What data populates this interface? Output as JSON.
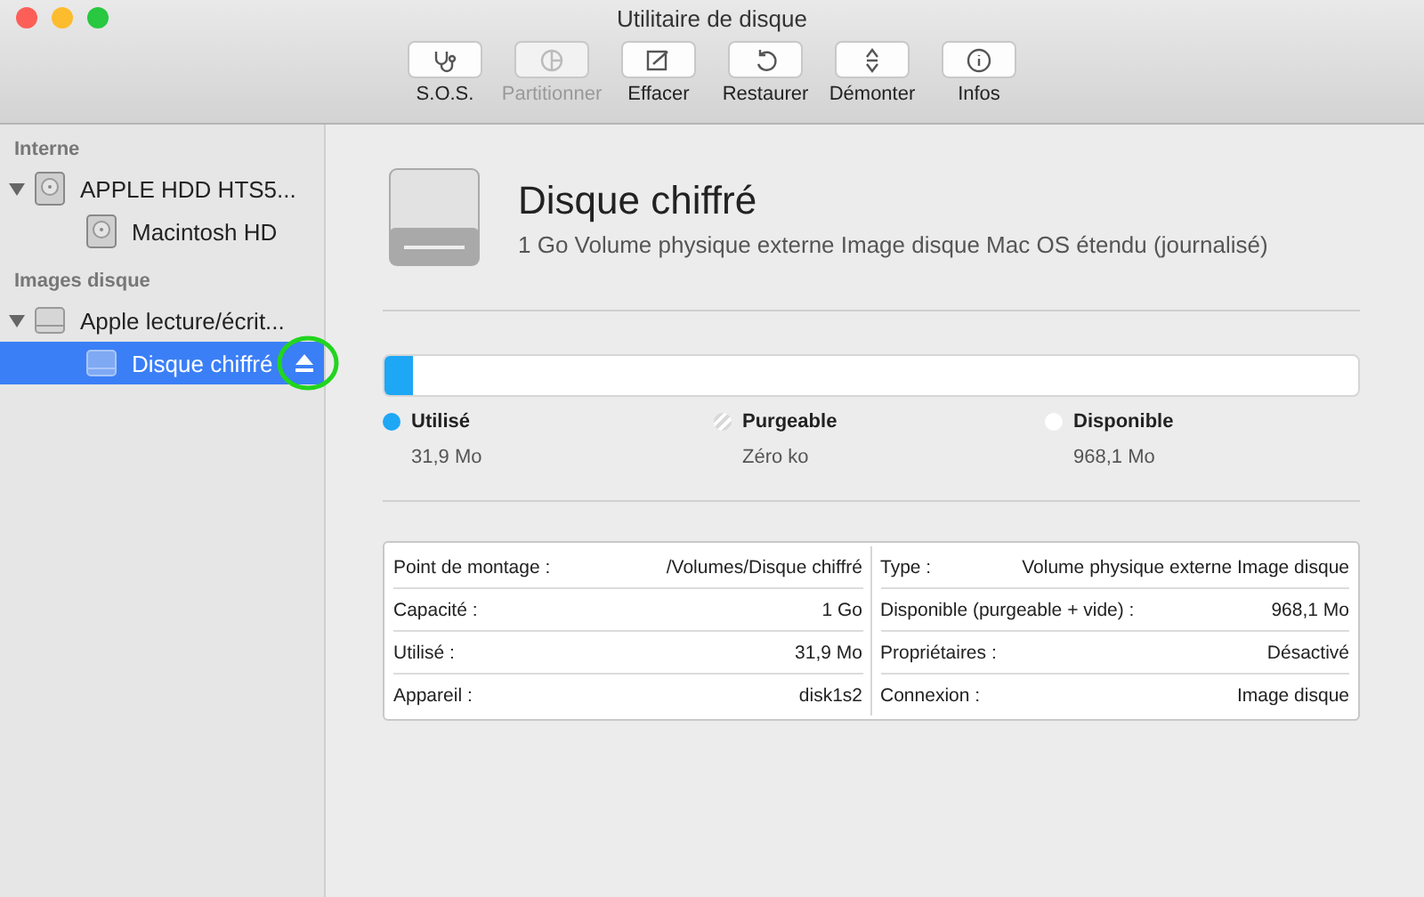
{
  "window": {
    "title": "Utilitaire de disque"
  },
  "toolbar": [
    {
      "label": "S.O.S.",
      "kind": "sos",
      "disabled": false
    },
    {
      "label": "Partitionner",
      "kind": "partition",
      "disabled": true
    },
    {
      "label": "Effacer",
      "kind": "erase",
      "disabled": false
    },
    {
      "label": "Restaurer",
      "kind": "restore",
      "disabled": false
    },
    {
      "label": "Démonter",
      "kind": "unmount",
      "disabled": false
    },
    {
      "label": "Infos",
      "kind": "info",
      "disabled": false
    }
  ],
  "sidebar": {
    "sections": [
      {
        "title": "Interne",
        "items": [
          {
            "label": "APPLE HDD HTS5...",
            "kind": "hdd",
            "expanded": true,
            "selected": false,
            "children": [
              {
                "label": "Macintosh HD",
                "kind": "hdd",
                "selected": false,
                "eject": false
              }
            ]
          }
        ]
      },
      {
        "title": "Images disque",
        "items": [
          {
            "label": "Apple lecture/écrit...",
            "kind": "image",
            "expanded": true,
            "selected": false,
            "children": [
              {
                "label": "Disque chiffré",
                "kind": "image",
                "selected": true,
                "eject": true
              }
            ]
          }
        ]
      }
    ]
  },
  "volume": {
    "name": "Disque chiffré",
    "description": "1 Go Volume physique externe Image disque Mac OS étendu (journalisé)"
  },
  "usage": {
    "level": 0.03,
    "legend": [
      {
        "label": "Utilisé",
        "value": "31,9 Mo",
        "color": "#1ea7f5",
        "kind": "solid"
      },
      {
        "label": "Purgeable",
        "value": "Zéro ko",
        "color": "#ffffff",
        "kind": "striped"
      },
      {
        "label": "Disponible",
        "value": "968,1 Mo",
        "color": "#ffffff",
        "kind": "solid"
      }
    ]
  },
  "info": {
    "left": [
      {
        "label": "Point de montage :",
        "value": "/Volumes/Disque chiffré"
      },
      {
        "label": "Capacité :",
        "value": "1 Go"
      },
      {
        "label": "Utilisé :",
        "value": "31,9 Mo"
      },
      {
        "label": "Appareil :",
        "value": "disk1s2"
      }
    ],
    "right": [
      {
        "label": "Type :",
        "value": "Volume physique externe Image disque"
      },
      {
        "label": "Disponible (purgeable + vide) :",
        "value": "968,1 Mo"
      },
      {
        "label": "Propriétaires :",
        "value": "Désactivé"
      },
      {
        "label": "Connexion :",
        "value": "Image disque"
      }
    ]
  }
}
